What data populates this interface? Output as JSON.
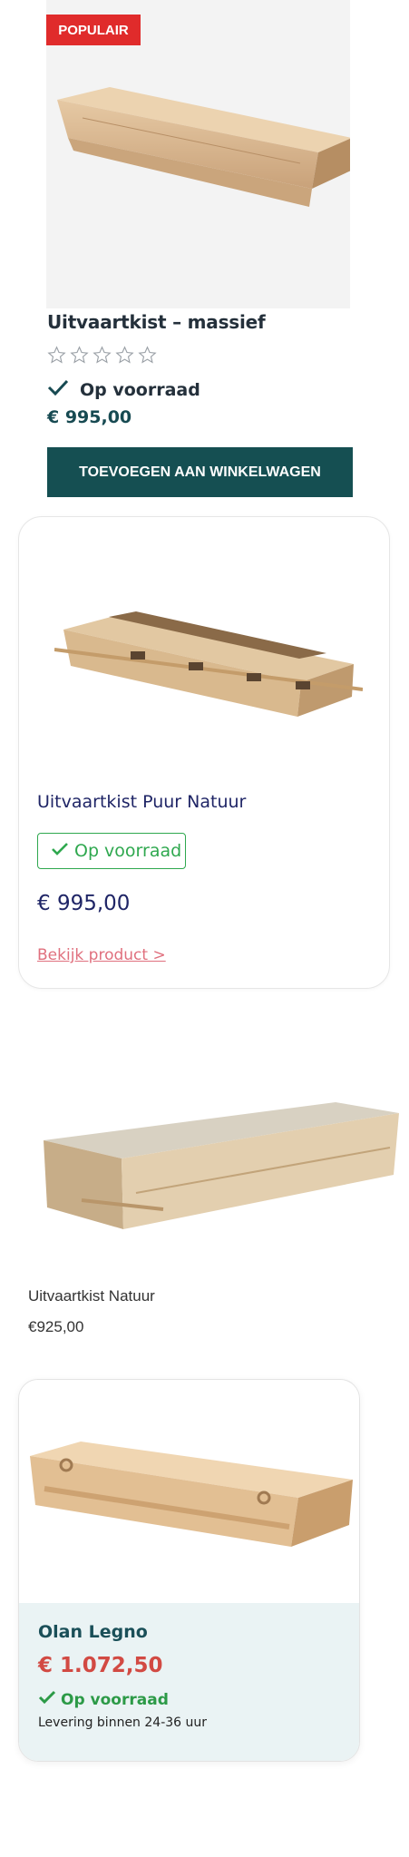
{
  "products": [
    {
      "badge": "POPULAIR",
      "title": "Uitvaartkist – massief",
      "rating_stars": 0,
      "rating_max": 5,
      "stock": "Op voorraad",
      "price": "€ 995,00",
      "button": "TOEVOEGEN AAN WINKELWAGEN",
      "image_icon": "coffin-image"
    },
    {
      "title": "Uitvaartkist Puur Natuur",
      "stock": "Op voorraad",
      "price": "€ 995,00",
      "link": "Bekijk product >",
      "image_icon": "coffin-image"
    },
    {
      "title": "Uitvaartkist Natuur",
      "price": "€925,00",
      "image_icon": "coffin-image"
    },
    {
      "title": "Olan Legno",
      "price": "€ 1.072,50",
      "stock": "Op voorraad",
      "delivery": "Levering binnen 24-36 uur",
      "image_icon": "coffin-image"
    }
  ],
  "colors": {
    "badge_red": "#e02b2b",
    "button_teal": "#154f52",
    "stock_green": "#2fa84f",
    "price_red": "#d24a43",
    "link_pink": "#e0707e"
  }
}
